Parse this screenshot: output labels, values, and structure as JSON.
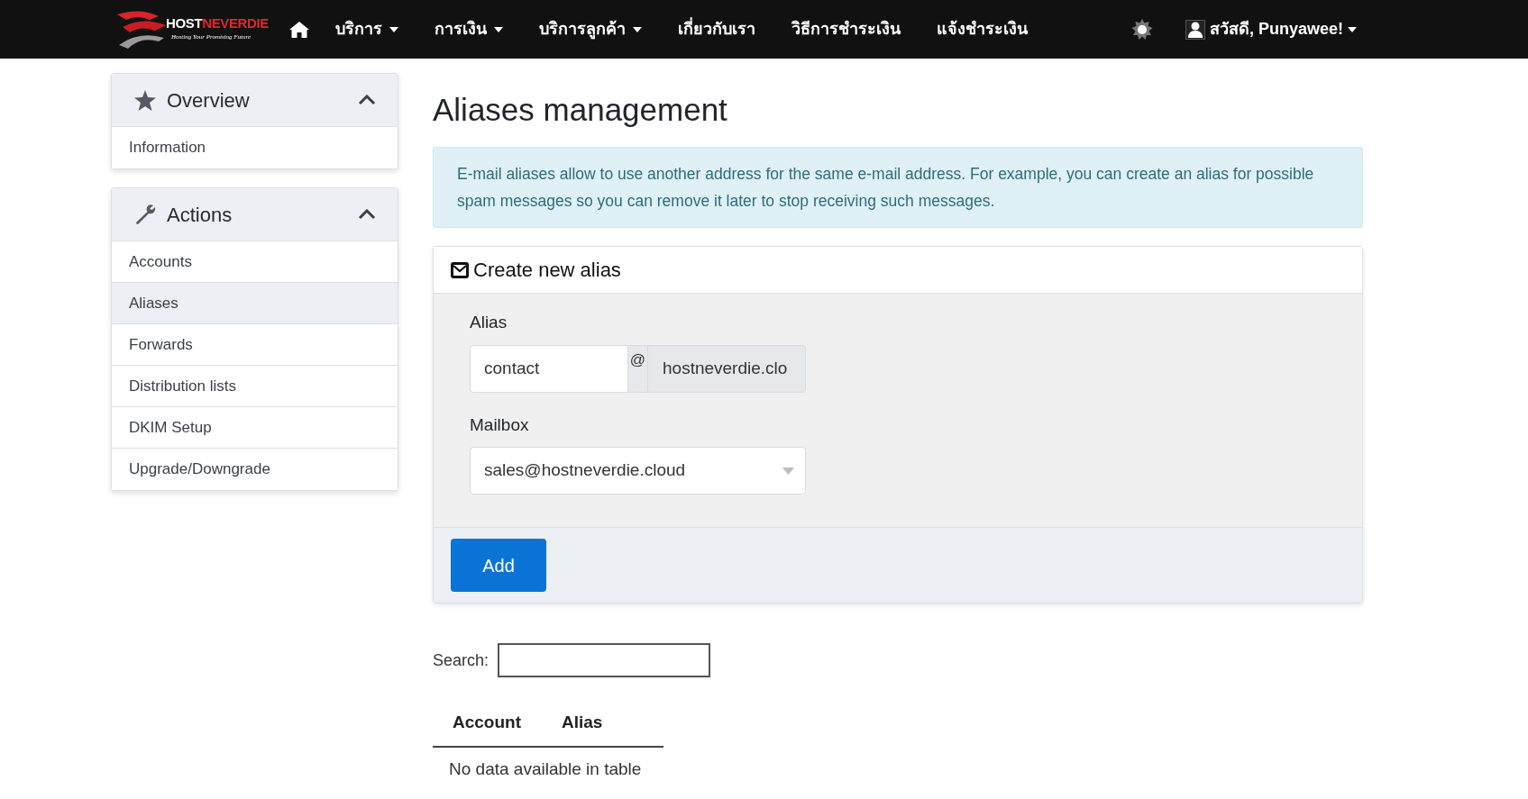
{
  "navbar": {
    "logo": {
      "name_first": "HOST",
      "name_second": "NEVERDIE",
      "tagline": "Hosting Your Promising Future"
    },
    "items": [
      {
        "kind": "home"
      },
      {
        "kind": "dropdown",
        "label": "บริการ"
      },
      {
        "kind": "dropdown",
        "label": "การเงิน"
      },
      {
        "kind": "dropdown",
        "label": "บริการลูกค้า"
      },
      {
        "kind": "link",
        "label": "เกี่ยวกับเรา"
      },
      {
        "kind": "link",
        "label": "วิธีการชำระเงิน"
      },
      {
        "kind": "link",
        "label": "แจ้งชำระเงิน"
      }
    ],
    "user": "สวัสดี, Punyawee!"
  },
  "sidebar": [
    {
      "kind": "star",
      "title": "Overview",
      "expanded": true,
      "items": [
        {
          "label": "Information",
          "selected": false
        }
      ]
    },
    {
      "kind": "wrench",
      "title": "Actions",
      "expanded": true,
      "items": [
        {
          "label": "Accounts",
          "selected": false
        },
        {
          "label": "Aliases",
          "selected": true
        },
        {
          "label": "Forwards",
          "selected": false
        },
        {
          "label": "Distribution lists",
          "selected": false
        },
        {
          "label": "DKIM Setup",
          "selected": false
        },
        {
          "label": "Upgrade/Downgrade",
          "selected": false
        }
      ]
    }
  ],
  "main": {
    "title": "Aliases management",
    "info": "E-mail aliases allow to use another address for the same e-mail address. For example, you can create an alias for possible spam messages so you can remove it later to stop receiving such messages.",
    "card": {
      "title": "Create new alias",
      "alias_label": "Alias",
      "alias_value": "contact",
      "at": "@",
      "domain": "hostneverdie.clo",
      "mailbox_label": "Mailbox",
      "mailbox_value": "sales@hostneverdie.cloud",
      "button": "Add"
    },
    "search_label": "Search:",
    "table": {
      "columns": [
        "Account",
        "Alias"
      ],
      "empty": "No data available in table"
    }
  }
}
